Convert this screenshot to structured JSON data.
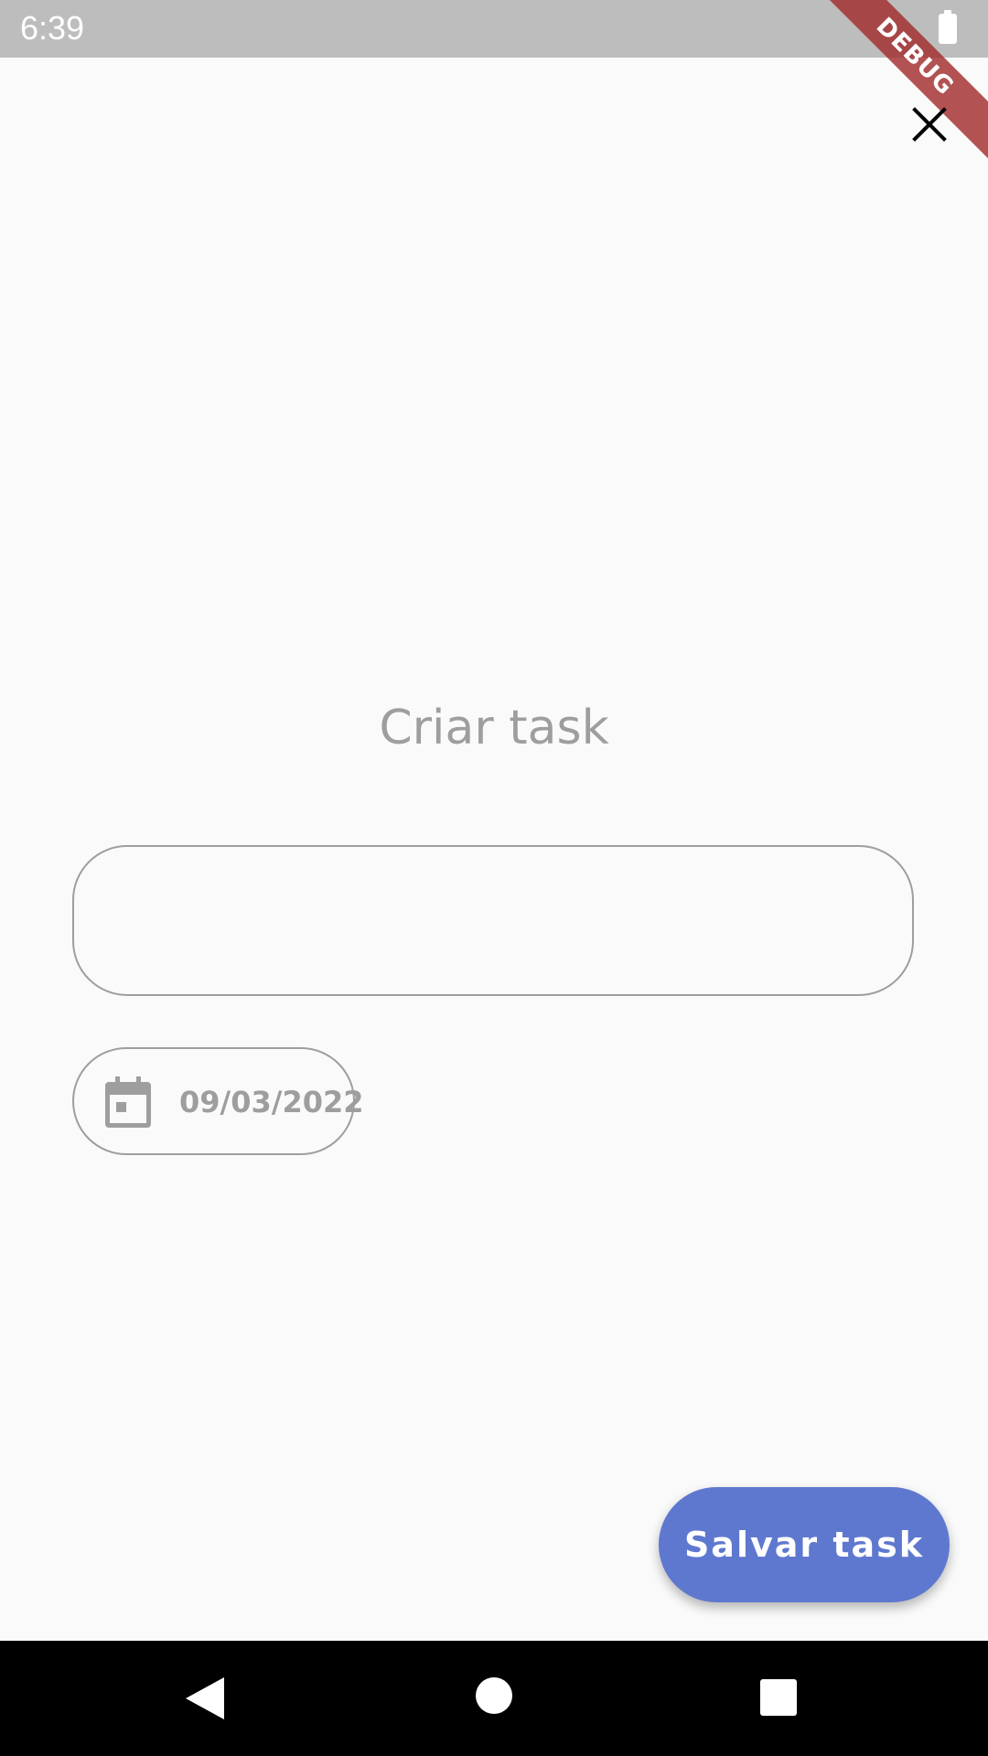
{
  "status_bar": {
    "time": "6:39",
    "battery_icon": "battery-full-icon"
  },
  "debug_banner": {
    "label": "DEBUG",
    "color": "#a02828"
  },
  "header": {
    "close_icon": "close-icon"
  },
  "main": {
    "title": "Criar task",
    "task_input": {
      "value": "",
      "placeholder": ""
    },
    "date_chip": {
      "icon": "calendar-icon",
      "date": "09/03/2022"
    }
  },
  "actions": {
    "save_label": "Salvar task",
    "save_color": "#5f78cf"
  },
  "navigation": {
    "back_icon": "back-icon",
    "home_icon": "home-icon",
    "recents_icon": "recents-icon"
  }
}
